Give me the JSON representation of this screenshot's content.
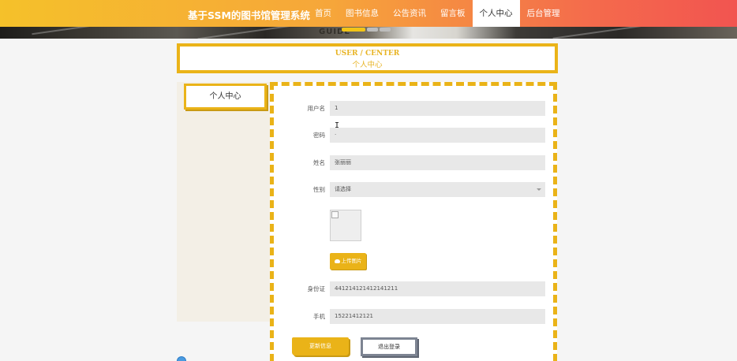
{
  "header": {
    "site_title": "基于SSM的图书馆管理系统",
    "nav": [
      "首页",
      "图书信息",
      "公告资讯",
      "留言板",
      "个人中心",
      "后台管理"
    ],
    "active_nav": "个人中心"
  },
  "banner": {
    "text": "GUIDE"
  },
  "page_title": {
    "en": "USER / CENTER",
    "cn": "个人中心"
  },
  "sidebar": {
    "items": [
      {
        "label": "个人中心"
      }
    ]
  },
  "form": {
    "username": {
      "label": "用户名",
      "value": "1"
    },
    "password": {
      "label": "密码",
      "value": "·"
    },
    "name": {
      "label": "姓名",
      "value": "张丽丽"
    },
    "gender": {
      "label": "性别",
      "placeholder": "请选择"
    },
    "upload_label": "上传图片",
    "id_card": {
      "label": "身份证",
      "value": "441214121412141211"
    },
    "phone": {
      "label": "手机",
      "value": "15221412121"
    }
  },
  "buttons": {
    "update": "更新信息",
    "logout": "退出登录"
  },
  "colors": {
    "accent": "#eab318",
    "header_start": "#f5c12a",
    "header_end": "#f25450",
    "logout_border": "#7d8492"
  },
  "icons": {
    "upload": "cloud-upload-icon",
    "cursor": "text-cursor-icon"
  }
}
